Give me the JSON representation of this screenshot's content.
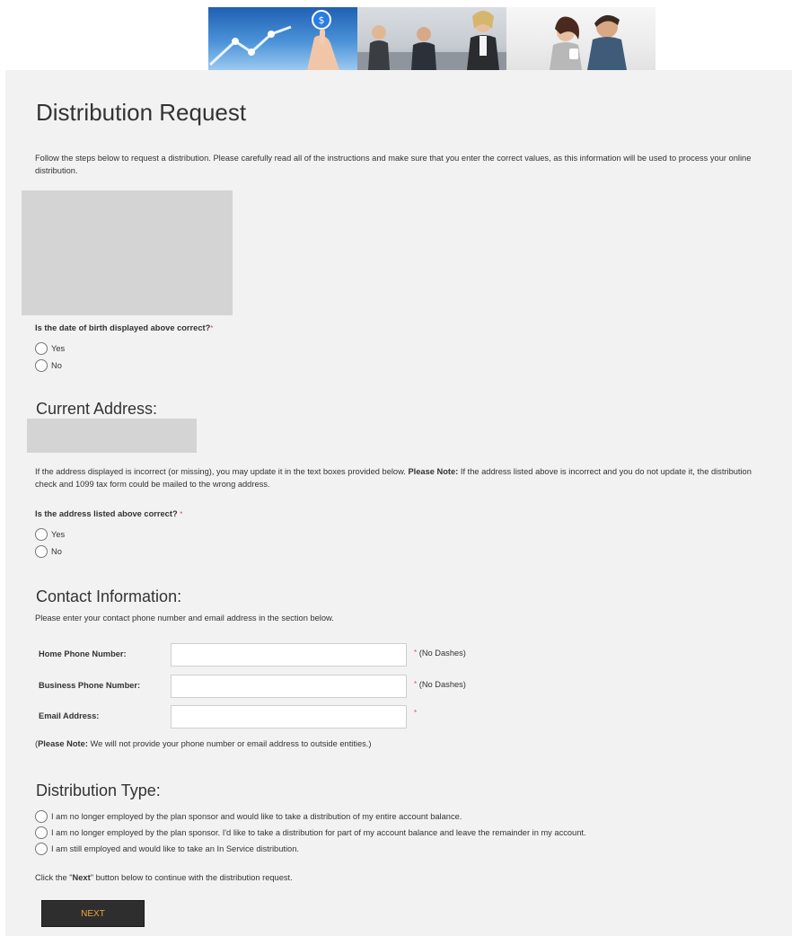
{
  "page": {
    "title": "Distribution Request",
    "intro": "Follow the steps below to request a distribution. Please carefully read all of the instructions and make sure that you enter the correct values, as this information will be used to process your online distribution."
  },
  "dob": {
    "question": "Is the date of birth displayed above correct?",
    "required_mark": "*",
    "options": [
      "Yes",
      "No"
    ]
  },
  "address": {
    "heading": "Current Address:",
    "notice_pre": "If the address displayed is incorrect (or missing), you may update it in the text boxes provided below. ",
    "notice_bold": "Please Note:",
    "notice_post": " If the address listed above is incorrect and you do not update it, the distribution check and 1099 tax form could be mailed to the wrong address.",
    "question": "Is the address listed above correct?",
    "required_mark": "*",
    "options": [
      "Yes",
      "No"
    ]
  },
  "contact": {
    "heading": "Contact Information:",
    "instructions": "Please enter your contact phone number and email address in the section below.",
    "fields": [
      {
        "label": "Home Phone Number:",
        "value": "",
        "required_mark": "*",
        "hint": "(No Dashes)"
      },
      {
        "label": "Business Phone Number:",
        "value": "",
        "required_mark": "*",
        "hint": "(No Dashes)"
      },
      {
        "label": "Email Address:",
        "value": "",
        "required_mark": "*",
        "hint": ""
      }
    ],
    "note_open": "(",
    "note_bold": "Please Note:",
    "note_rest": " We will not provide your phone number or email address to outside entities.)"
  },
  "distribution": {
    "heading": "Distribution Type:",
    "options": [
      "I am no longer employed by the plan sponsor and would like to take a distribution of my entire account balance.",
      "I am no longer employed by the plan sponsor. I'd like to take a distribution for part of my account balance and leave the remainder in my account.",
      "I am still employed and would like to take an In Service distribution."
    ],
    "continue_pre": "Click the \"",
    "continue_bold": "Next",
    "continue_post": "\" button below to continue with the distribution request."
  },
  "actions": {
    "next_label": "NEXT"
  },
  "colors": {
    "panel_bg": "#f2f2f2",
    "required": "#e04a4a",
    "button_bg": "#2e2e2e",
    "button_text": "#f0a53a"
  },
  "icons": {
    "banner_1": "stock-chart-image",
    "banner_2": "business-meeting-image",
    "banner_3": "couple-image"
  }
}
